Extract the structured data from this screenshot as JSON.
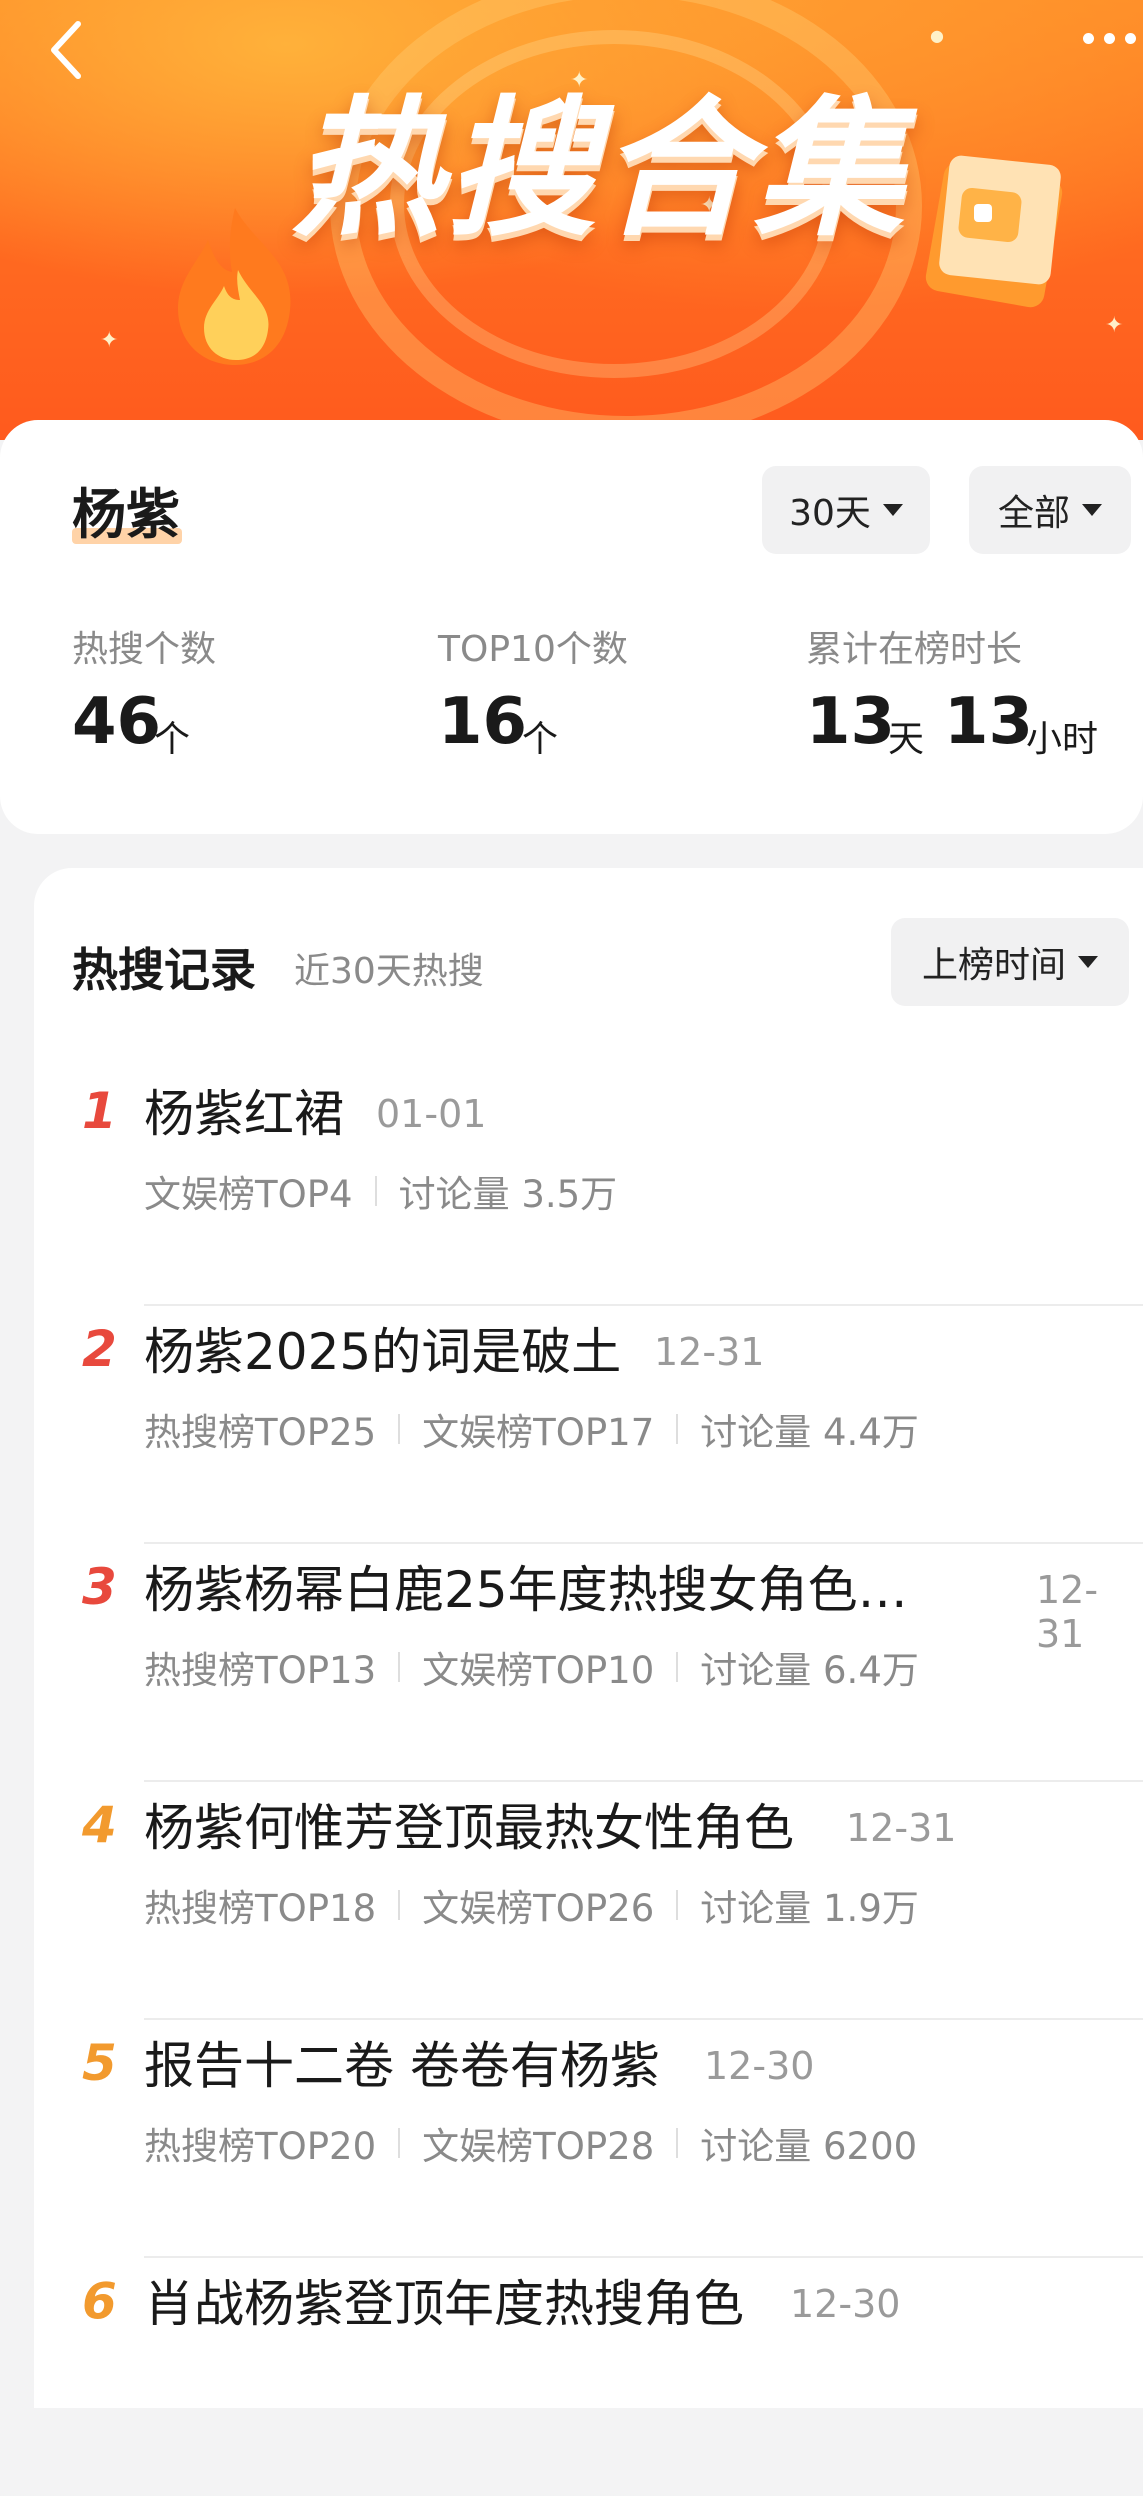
{
  "banner": {
    "title": "热搜合集"
  },
  "summary": {
    "keyword": "杨紫",
    "range_dropdown": "30天",
    "category_dropdown": "全部",
    "stats": [
      {
        "label": "热搜个数",
        "value": "46",
        "unit": "个"
      },
      {
        "label": "TOP10个数",
        "value": "16",
        "unit": "个"
      },
      {
        "label": "累计在榜时长",
        "days": "13",
        "days_unit": "天",
        "hours": "13",
        "hours_unit": "小时"
      }
    ]
  },
  "records": {
    "title": "热搜记录",
    "subtitle": "近30天热搜",
    "sort_dropdown": "上榜时间",
    "items": [
      {
        "rank": "1",
        "title": "杨紫红裙",
        "date": "01-01",
        "meta": [
          "文娱榜TOP4",
          "讨论量 3.5万"
        ]
      },
      {
        "rank": "2",
        "title": "杨紫2025的词是破土",
        "date": "12-31",
        "meta": [
          "热搜榜TOP25",
          "文娱榜TOP17",
          "讨论量 4.4万"
        ]
      },
      {
        "rank": "3",
        "title": "杨紫杨幂白鹿25年度热搜女角色…",
        "date": "12-31",
        "meta": [
          "热搜榜TOP13",
          "文娱榜TOP10",
          "讨论量 6.4万"
        ]
      },
      {
        "rank": "4",
        "title": "杨紫何惟芳登顶最热女性角色",
        "date": "12-31",
        "meta": [
          "热搜榜TOP18",
          "文娱榜TOP26",
          "讨论量 1.9万"
        ]
      },
      {
        "rank": "5",
        "title": "报告十二卷 卷卷有杨紫",
        "date": "12-30",
        "meta": [
          "热搜榜TOP20",
          "文娱榜TOP28",
          "讨论量 6200"
        ]
      },
      {
        "rank": "6",
        "title": "肖战杨紫登顶年度热搜角色",
        "date": "12-30",
        "meta": []
      }
    ]
  },
  "colors": {
    "banner_orange": "#ff6a20",
    "rank_top3": "#e8493d",
    "rank_other": "#f29a2e",
    "keyword_highlight": "#ffd3a8"
  }
}
